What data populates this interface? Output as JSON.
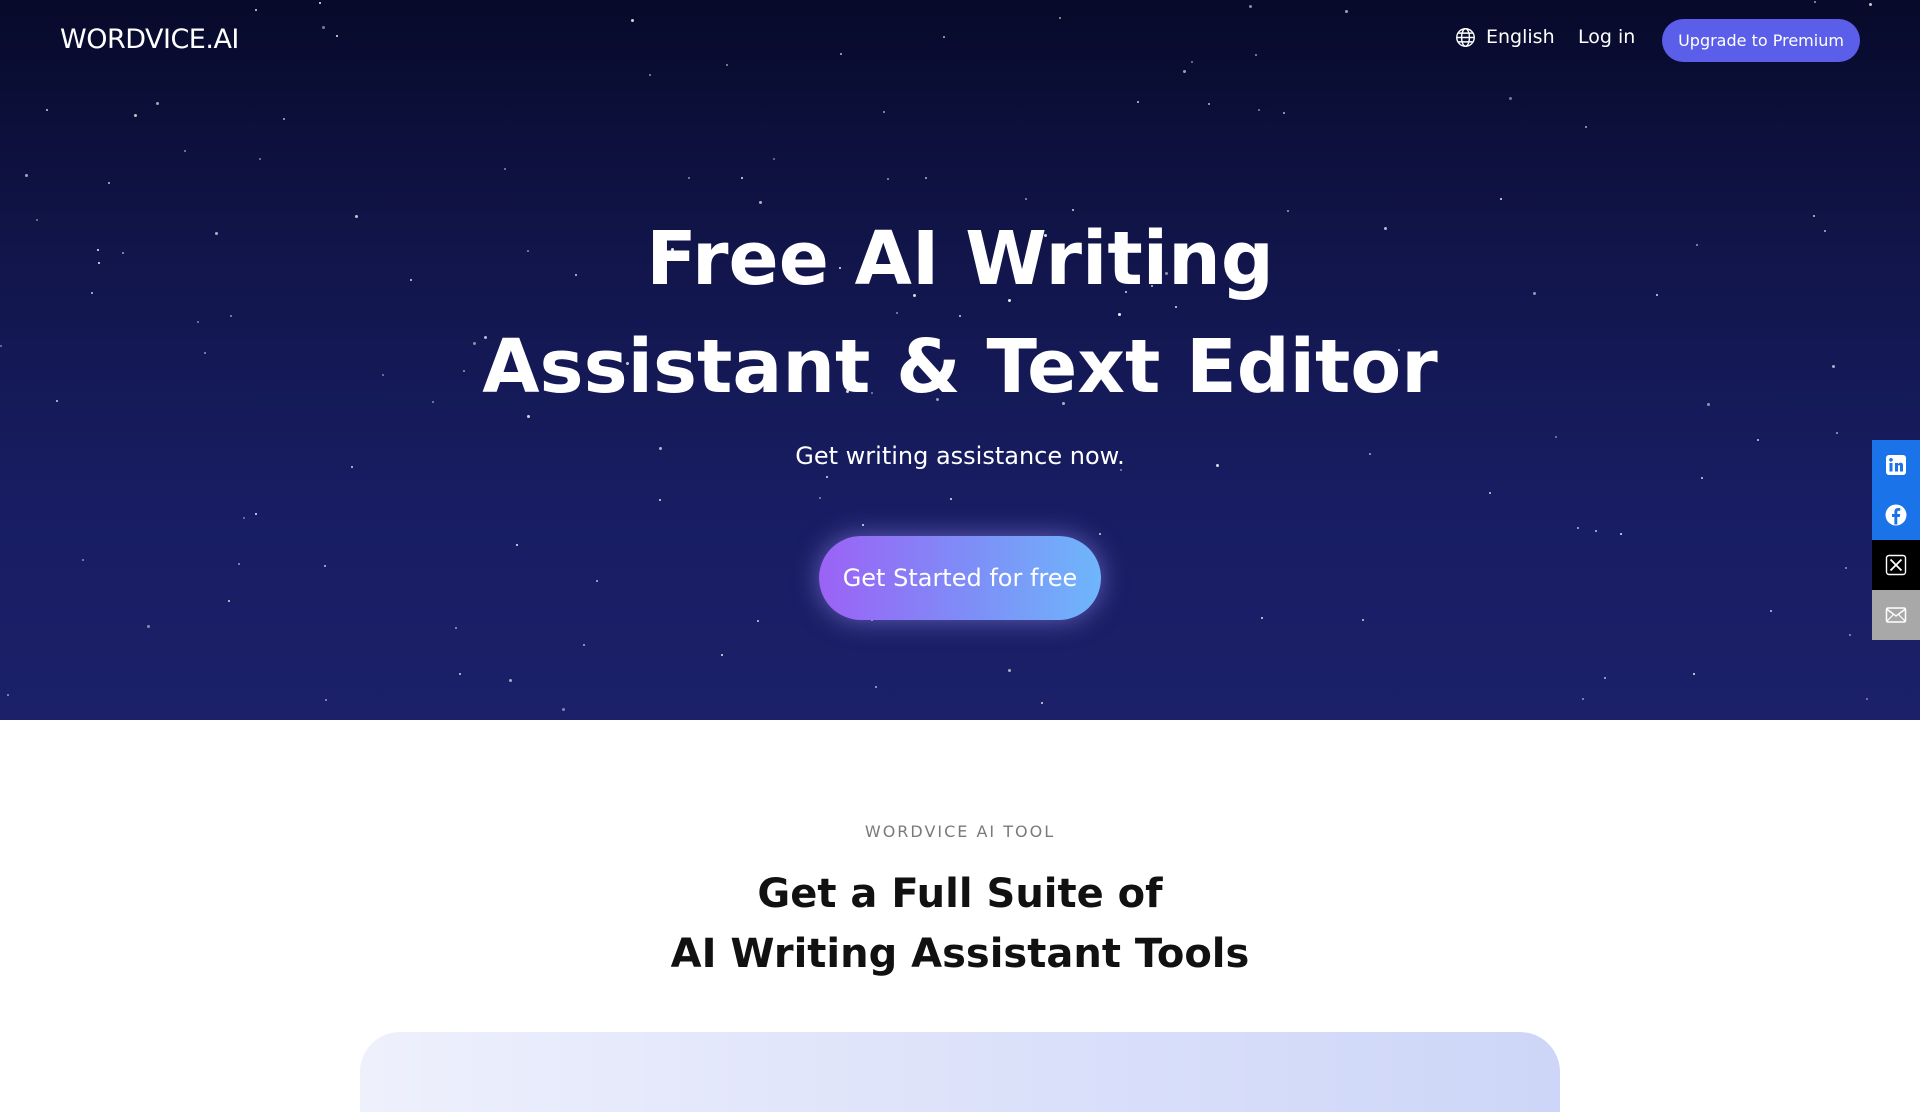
{
  "nav": {
    "logo": "WORDVICE.AI",
    "language": "English",
    "login": "Log in",
    "premium": "Upgrade to Premium"
  },
  "hero": {
    "title_line1": "Free AI Writing",
    "title_line2": "Assistant & Text Editor",
    "subtitle": "Get writing assistance now.",
    "cta": "Get Started for free"
  },
  "share": {
    "items": [
      {
        "icon": "linkedin-icon",
        "color": "#1a73e8"
      },
      {
        "icon": "facebook-icon",
        "color": "#1a73e8"
      },
      {
        "icon": "x-icon",
        "color": "#000000"
      },
      {
        "icon": "mail-icon",
        "color": "#a8a8a8"
      }
    ]
  },
  "section": {
    "label": "WORDVICE AI TOOL",
    "title_line1": "Get a Full Suite of",
    "title_line2": "AI Writing Assistant Tools"
  },
  "colors": {
    "hero_top": "#070a2a",
    "hero_bottom": "#1b2068",
    "premium_button": "#5b5ee8",
    "cta_start": "#9b62f5",
    "cta_end": "#6fb6fb"
  }
}
